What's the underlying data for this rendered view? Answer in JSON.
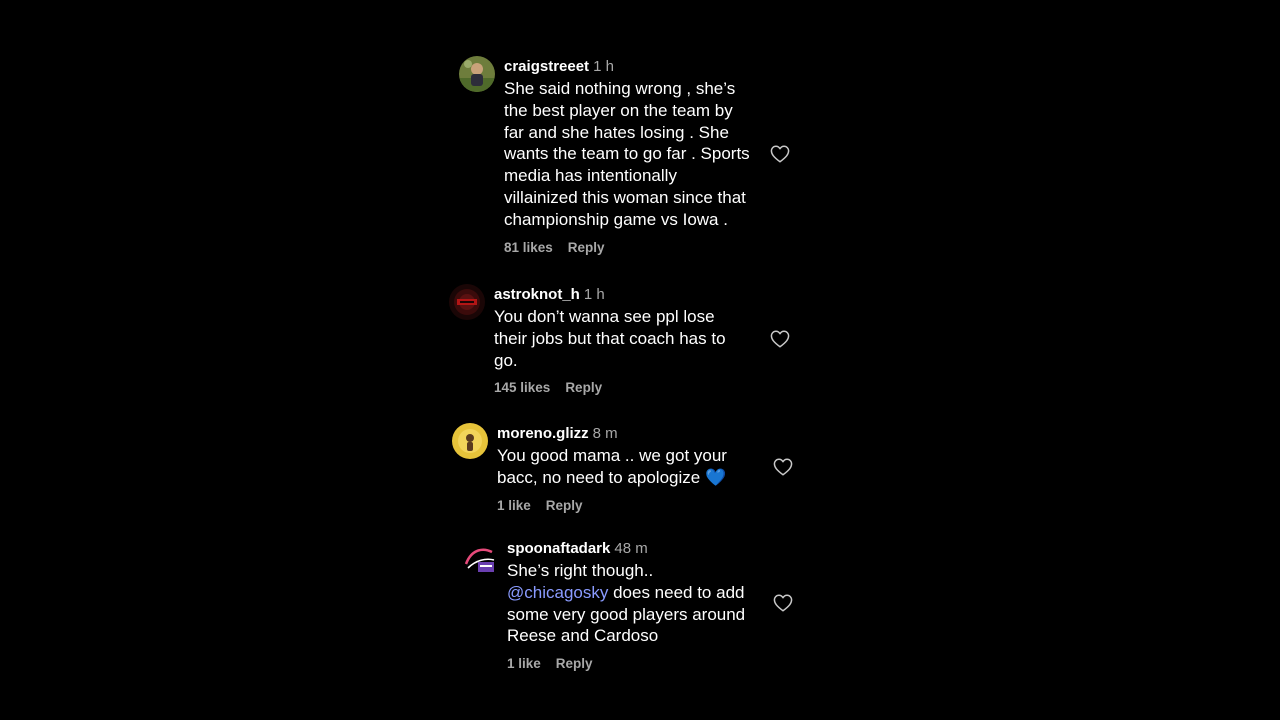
{
  "comments": [
    {
      "username": "craigstreeet",
      "time": "1 h",
      "lines": [
        "She said nothing wrong , she’s",
        "the best player on the team by",
        "far and she hates losing . She",
        "wants the team to go far . Sports",
        "media has intentionally",
        "villainized this woman since that",
        "championship game vs Iowa ."
      ],
      "likes": "81 likes",
      "reply": "Reply",
      "avatar_icon": "profile-photo-icon"
    },
    {
      "username": "astroknot_h",
      "time": "1 h",
      "lines": [
        "You don’t wanna see ppl lose",
        "their jobs but that coach has to",
        "go."
      ],
      "likes": "145 likes",
      "reply": "Reply",
      "avatar_icon": "profile-photo-icon"
    },
    {
      "username": "moreno.glizz",
      "time": "8 m",
      "lines": [
        "You good mama .. we got your",
        "bacc, no need to apologize"
      ],
      "emoji": "💙",
      "likes": "1 like",
      "reply": "Reply",
      "avatar_icon": "profile-photo-icon"
    },
    {
      "username": "spoonaftadark",
      "time": "48 m",
      "line1": "She’s right though..",
      "mention": "@chicagosky",
      "line2_rest": " does need to add",
      "line3": "some very good players around",
      "line4": "Reese and Cardoso",
      "likes": "1 like",
      "reply": "Reply",
      "avatar_icon": "profile-logo-icon"
    }
  ],
  "colors": {
    "background": "#000000",
    "text": "#ffffff",
    "secondary": "#a8a8a8",
    "mention": "#8a9bff",
    "heart_outline": "#c8c8c8"
  },
  "icons": {
    "like": "heart-outline-icon"
  }
}
